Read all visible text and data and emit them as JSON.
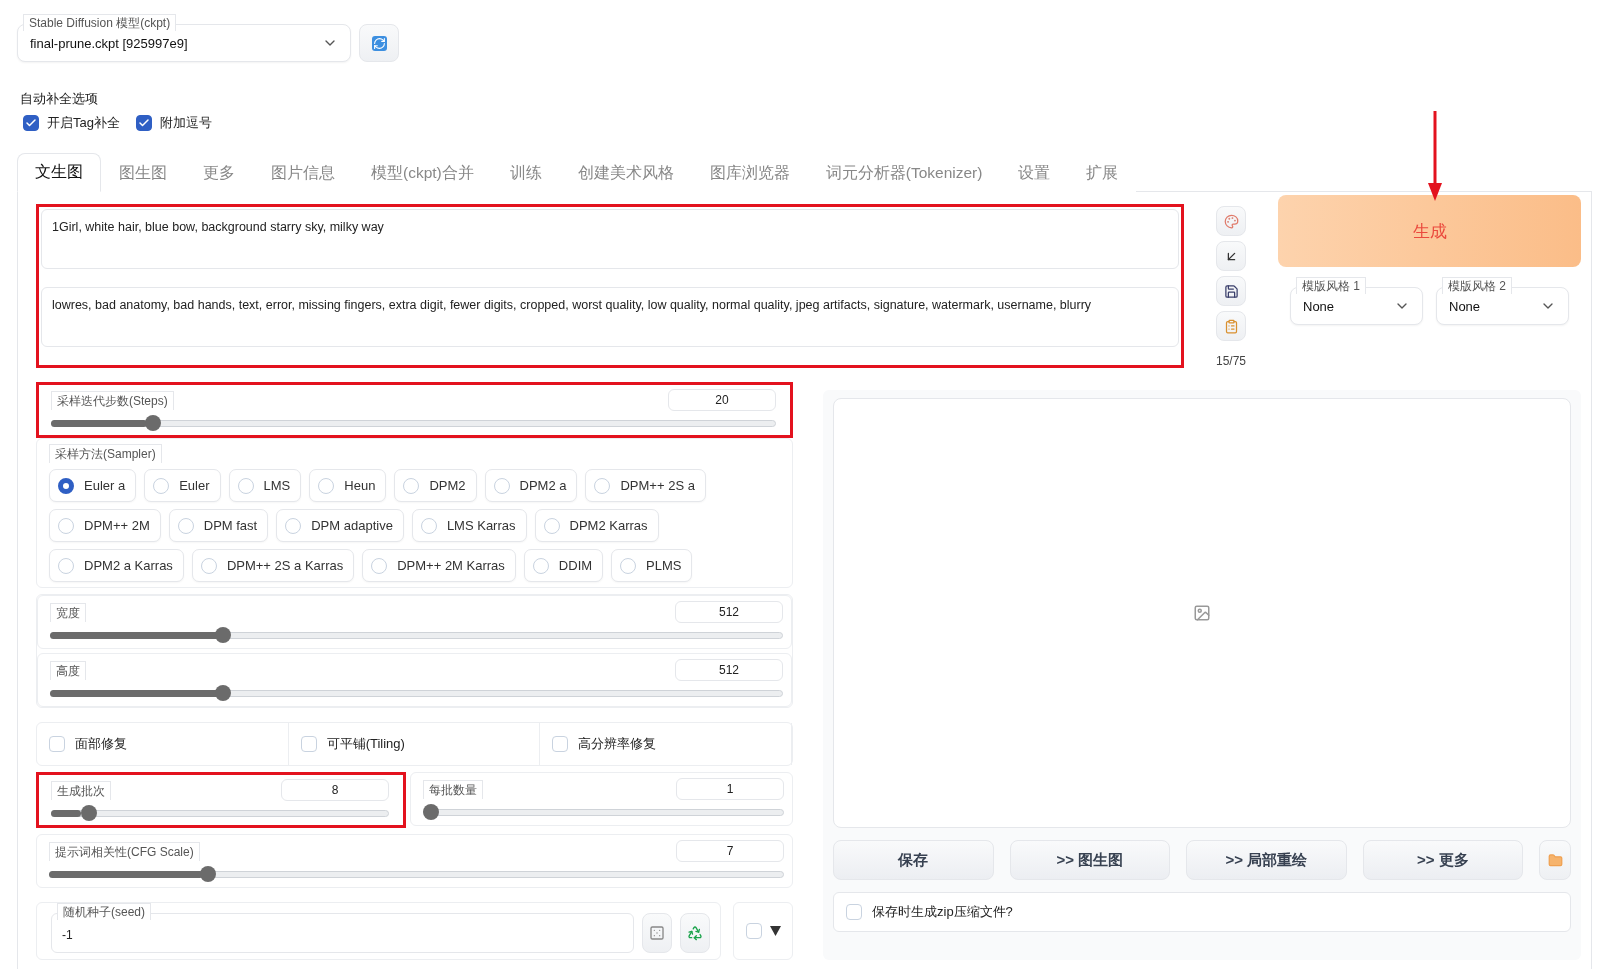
{
  "model_select": {
    "label": "Stable Diffusion 模型(ckpt)",
    "value": "final-prune.ckpt [925997e9]"
  },
  "autocomplete": {
    "title": "自动补全选项",
    "options": [
      {
        "label": "开启Tag补全",
        "checked": true
      },
      {
        "label": "附加逗号",
        "checked": true
      }
    ]
  },
  "tabs": [
    {
      "label": "文生图",
      "selected": true
    },
    {
      "label": "图生图",
      "selected": false
    },
    {
      "label": "更多",
      "selected": false
    },
    {
      "label": "图片信息",
      "selected": false
    },
    {
      "label": "模型(ckpt)合并",
      "selected": false
    },
    {
      "label": "训练",
      "selected": false
    },
    {
      "label": "创建美术风格",
      "selected": false
    },
    {
      "label": "图库浏览器",
      "selected": false
    },
    {
      "label": "词元分析器(Tokenizer)",
      "selected": false
    },
    {
      "label": "设置",
      "selected": false
    },
    {
      "label": "扩展",
      "selected": false
    }
  ],
  "prompt": {
    "highlighted": true,
    "positive": "1Girl, white hair, blue bow, background starry sky, milky way",
    "negative": "lowres, bad anatomy, bad hands, text, error, missing fingers, extra digit, fewer digits, cropped, worst quality, low quality, normal quality, jpeg artifacts, signature, watermark, username, blurry"
  },
  "token_count": "15/75",
  "generate": {
    "label": "生成",
    "arrow": true
  },
  "styles": [
    {
      "label": "模版风格 1",
      "value": "None"
    },
    {
      "label": "模版风格 2",
      "value": "None"
    }
  ],
  "steps": {
    "label": "采样迭代步数(Steps)",
    "value": "20",
    "level": 0.133,
    "highlighted": true
  },
  "sampler": {
    "label": "采样方法(Sampler)",
    "options": [
      {
        "label": "Euler a",
        "selected": true
      },
      {
        "label": "Euler",
        "selected": false
      },
      {
        "label": "LMS",
        "selected": false
      },
      {
        "label": "Heun",
        "selected": false
      },
      {
        "label": "DPM2",
        "selected": false
      },
      {
        "label": "DPM2 a",
        "selected": false
      },
      {
        "label": "DPM++ 2S a",
        "selected": false
      },
      {
        "label": "DPM++ 2M",
        "selected": false
      },
      {
        "label": "DPM fast",
        "selected": false
      },
      {
        "label": "DPM adaptive",
        "selected": false
      },
      {
        "label": "LMS Karras",
        "selected": false
      },
      {
        "label": "DPM2 Karras",
        "selected": false
      },
      {
        "label": "DPM2 a Karras",
        "selected": false
      },
      {
        "label": "DPM++ 2S a Karras",
        "selected": false
      },
      {
        "label": "DPM++ 2M Karras",
        "selected": false
      },
      {
        "label": "DDIM",
        "selected": false
      },
      {
        "label": "PLMS",
        "selected": false
      }
    ]
  },
  "width": {
    "label": "宽度",
    "value": "512",
    "level": 0.23
  },
  "height": {
    "label": "高度",
    "value": "512",
    "level": 0.23
  },
  "options": [
    {
      "label": "面部修复",
      "checked": false
    },
    {
      "label": "可平铺(Tiling)",
      "checked": false
    },
    {
      "label": "高分辨率修复",
      "checked": false
    }
  ],
  "batch_count": {
    "label": "生成批次",
    "value": "8",
    "level": 0.09,
    "highlighted": true
  },
  "batch_size": {
    "label": "每批数量",
    "value": "1",
    "level": 0
  },
  "cfg_scale": {
    "label": "提示词相关性(CFG Scale)",
    "value": "7",
    "level": 0.21
  },
  "seed": {
    "label": "随机种子(seed)",
    "value": "-1"
  },
  "extra_seed": {
    "checked": false
  },
  "actions": [
    "保存",
    ">> 图生图",
    ">> 局部重绘",
    ">> 更多"
  ],
  "zip_option": {
    "label": "保存时生成zip压缩文件?",
    "checked": false
  }
}
